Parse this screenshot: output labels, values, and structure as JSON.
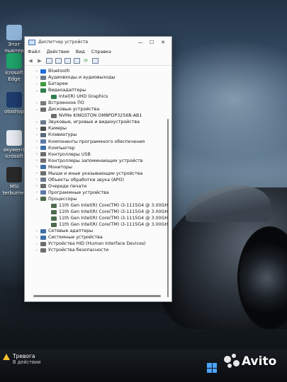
{
  "desktop": {
    "icons": [
      {
        "label_line1": "Этот",
        "label_line2": "пьютер",
        "icon": "this-pc-icon",
        "color": "#8fb4d8"
      },
      {
        "label_line1": "icrosoft",
        "label_line2": "Edge",
        "icon": "edge-icon",
        "color": "#1fa36b"
      },
      {
        "label_line1": "otoshop",
        "label_line2": "",
        "icon": "photoshop-icon",
        "color": "#1e3c6e"
      },
      {
        "label_line1": "окумент",
        "label_line2": "icrosoft",
        "icon": "word-document-icon",
        "color": "#e8ecf2"
      },
      {
        "label_line1": "MSI",
        "label_line2": "terburner",
        "icon": "msi-afterburner-icon",
        "color": "#2a2a2a"
      }
    ]
  },
  "window": {
    "title": "Диспетчер устройств",
    "controls": {
      "minimize": "—",
      "maximize": "☐",
      "close": "✕"
    },
    "menu": [
      "Файл",
      "Действие",
      "Вид",
      "Справка"
    ],
    "toolbar": [
      {
        "name": "back-button",
        "glyph": "◀"
      },
      {
        "name": "forward-button",
        "glyph": "▶"
      },
      {
        "name": "properties-button",
        "glyph": "box"
      },
      {
        "name": "details-button",
        "glyph": "box"
      },
      {
        "name": "help-button",
        "glyph": "box"
      },
      {
        "name": "update-driver-button",
        "glyph": "box"
      },
      {
        "name": "scan-hardware-button",
        "glyph": "green"
      },
      {
        "name": "monitor-button",
        "glyph": "box"
      }
    ],
    "tree": [
      {
        "label": "Bluetooth",
        "level": 0,
        "expanded": false,
        "icon": "bluetooth-icon",
        "color": "#1e6fd9"
      },
      {
        "label": "Аудиовходы и аудиовыходы",
        "level": 0,
        "expanded": false,
        "icon": "audio-icon",
        "color": "#6b7a8c"
      },
      {
        "label": "Батареи",
        "level": 0,
        "expanded": false,
        "icon": "battery-icon",
        "color": "#3d9a3d"
      },
      {
        "label": "Видеоадаптеры",
        "level": 0,
        "expanded": true,
        "icon": "display-adapter-icon",
        "color": "#2f7d4f"
      },
      {
        "label": "Intel(R) UHD Graphics",
        "level": 1,
        "expanded": null,
        "icon": "display-adapter-icon",
        "color": "#2f7d4f"
      },
      {
        "label": "Встроенное ПО",
        "level": 0,
        "expanded": false,
        "icon": "firmware-icon",
        "color": "#7a7a7a"
      },
      {
        "label": "Дисковые устройства",
        "level": 0,
        "expanded": true,
        "icon": "disk-drive-icon",
        "color": "#6d6d6d"
      },
      {
        "label": "NVMe KINGSTON OM8PDP3256B-AB1",
        "level": 1,
        "expanded": null,
        "icon": "disk-drive-icon",
        "color": "#6d6d6d"
      },
      {
        "label": "Звуковые, игровые и видеоустройства",
        "level": 0,
        "expanded": false,
        "icon": "sound-icon",
        "color": "#6b7a8c"
      },
      {
        "label": "Камеры",
        "level": 0,
        "expanded": false,
        "icon": "camera-icon",
        "color": "#4d4d4d"
      },
      {
        "label": "Клавиатуры",
        "level": 0,
        "expanded": false,
        "icon": "keyboard-icon",
        "color": "#5c6b7a"
      },
      {
        "label": "Компоненты программного обеспечения",
        "level": 0,
        "expanded": false,
        "icon": "software-component-icon",
        "color": "#5c7aa6"
      },
      {
        "label": "Компьютер",
        "level": 0,
        "expanded": false,
        "icon": "computer-icon",
        "color": "#3f6fa8"
      },
      {
        "label": "Контроллеры USB",
        "level": 0,
        "expanded": false,
        "icon": "usb-icon",
        "color": "#6d6d6d"
      },
      {
        "label": "Контроллеры запоминающих устройств",
        "level": 0,
        "expanded": false,
        "icon": "storage-controller-icon",
        "color": "#6d6d6d"
      },
      {
        "label": "Мониторы",
        "level": 0,
        "expanded": false,
        "icon": "monitor-icon",
        "color": "#3f6fa8"
      },
      {
        "label": "Мыши и иные указывающие устройства",
        "level": 0,
        "expanded": false,
        "icon": "mouse-icon",
        "color": "#6d6d6d"
      },
      {
        "label": "Объекты обработки звука (APO)",
        "level": 0,
        "expanded": false,
        "icon": "audio-processing-icon",
        "color": "#6b7a8c"
      },
      {
        "label": "Очереди печати",
        "level": 0,
        "expanded": false,
        "icon": "print-queue-icon",
        "color": "#6d6d6d"
      },
      {
        "label": "Программные устройства",
        "level": 0,
        "expanded": false,
        "icon": "software-device-icon",
        "color": "#5c7aa6"
      },
      {
        "label": "Процессоры",
        "level": 0,
        "expanded": true,
        "icon": "processor-icon",
        "color": "#4d6b4d"
      },
      {
        "label": "11th Gen Intel(R) Core(TM) i3-1115G4 @ 3.00GH",
        "level": 1,
        "expanded": null,
        "icon": "processor-icon",
        "color": "#4d6b4d"
      },
      {
        "label": "11th Gen Intel(R) Core(TM) i3-1115G4 @ 3.00GH",
        "level": 1,
        "expanded": null,
        "icon": "processor-icon",
        "color": "#4d6b4d"
      },
      {
        "label": "11th Gen Intel(R) Core(TM) i3-1115G4 @ 3.00GH",
        "level": 1,
        "expanded": null,
        "icon": "processor-icon",
        "color": "#4d6b4d"
      },
      {
        "label": "11th Gen Intel(R) Core(TM) i3-1115G4 @ 3.00GH",
        "level": 1,
        "expanded": null,
        "icon": "processor-icon",
        "color": "#4d6b4d"
      },
      {
        "label": "Сетевые адаптеры",
        "level": 0,
        "expanded": false,
        "icon": "network-adapter-icon",
        "color": "#3f6fa8"
      },
      {
        "label": "Системные устройства",
        "level": 0,
        "expanded": false,
        "icon": "system-device-icon",
        "color": "#3f6fa8"
      },
      {
        "label": "Устройства HID (Human Interface Devices)",
        "level": 0,
        "expanded": false,
        "icon": "hid-icon",
        "color": "#6d6d6d"
      },
      {
        "label": "Устройства безопасности",
        "level": 0,
        "expanded": false,
        "icon": "security-device-icon",
        "color": "#6d6d6d"
      }
    ]
  },
  "taskbar": {
    "alert_title": "Тревога",
    "alert_subtitle": "В действии",
    "alert_color": "#f2c12e",
    "start_color": "#4aa3ff"
  },
  "watermark": {
    "text": "Avito"
  }
}
